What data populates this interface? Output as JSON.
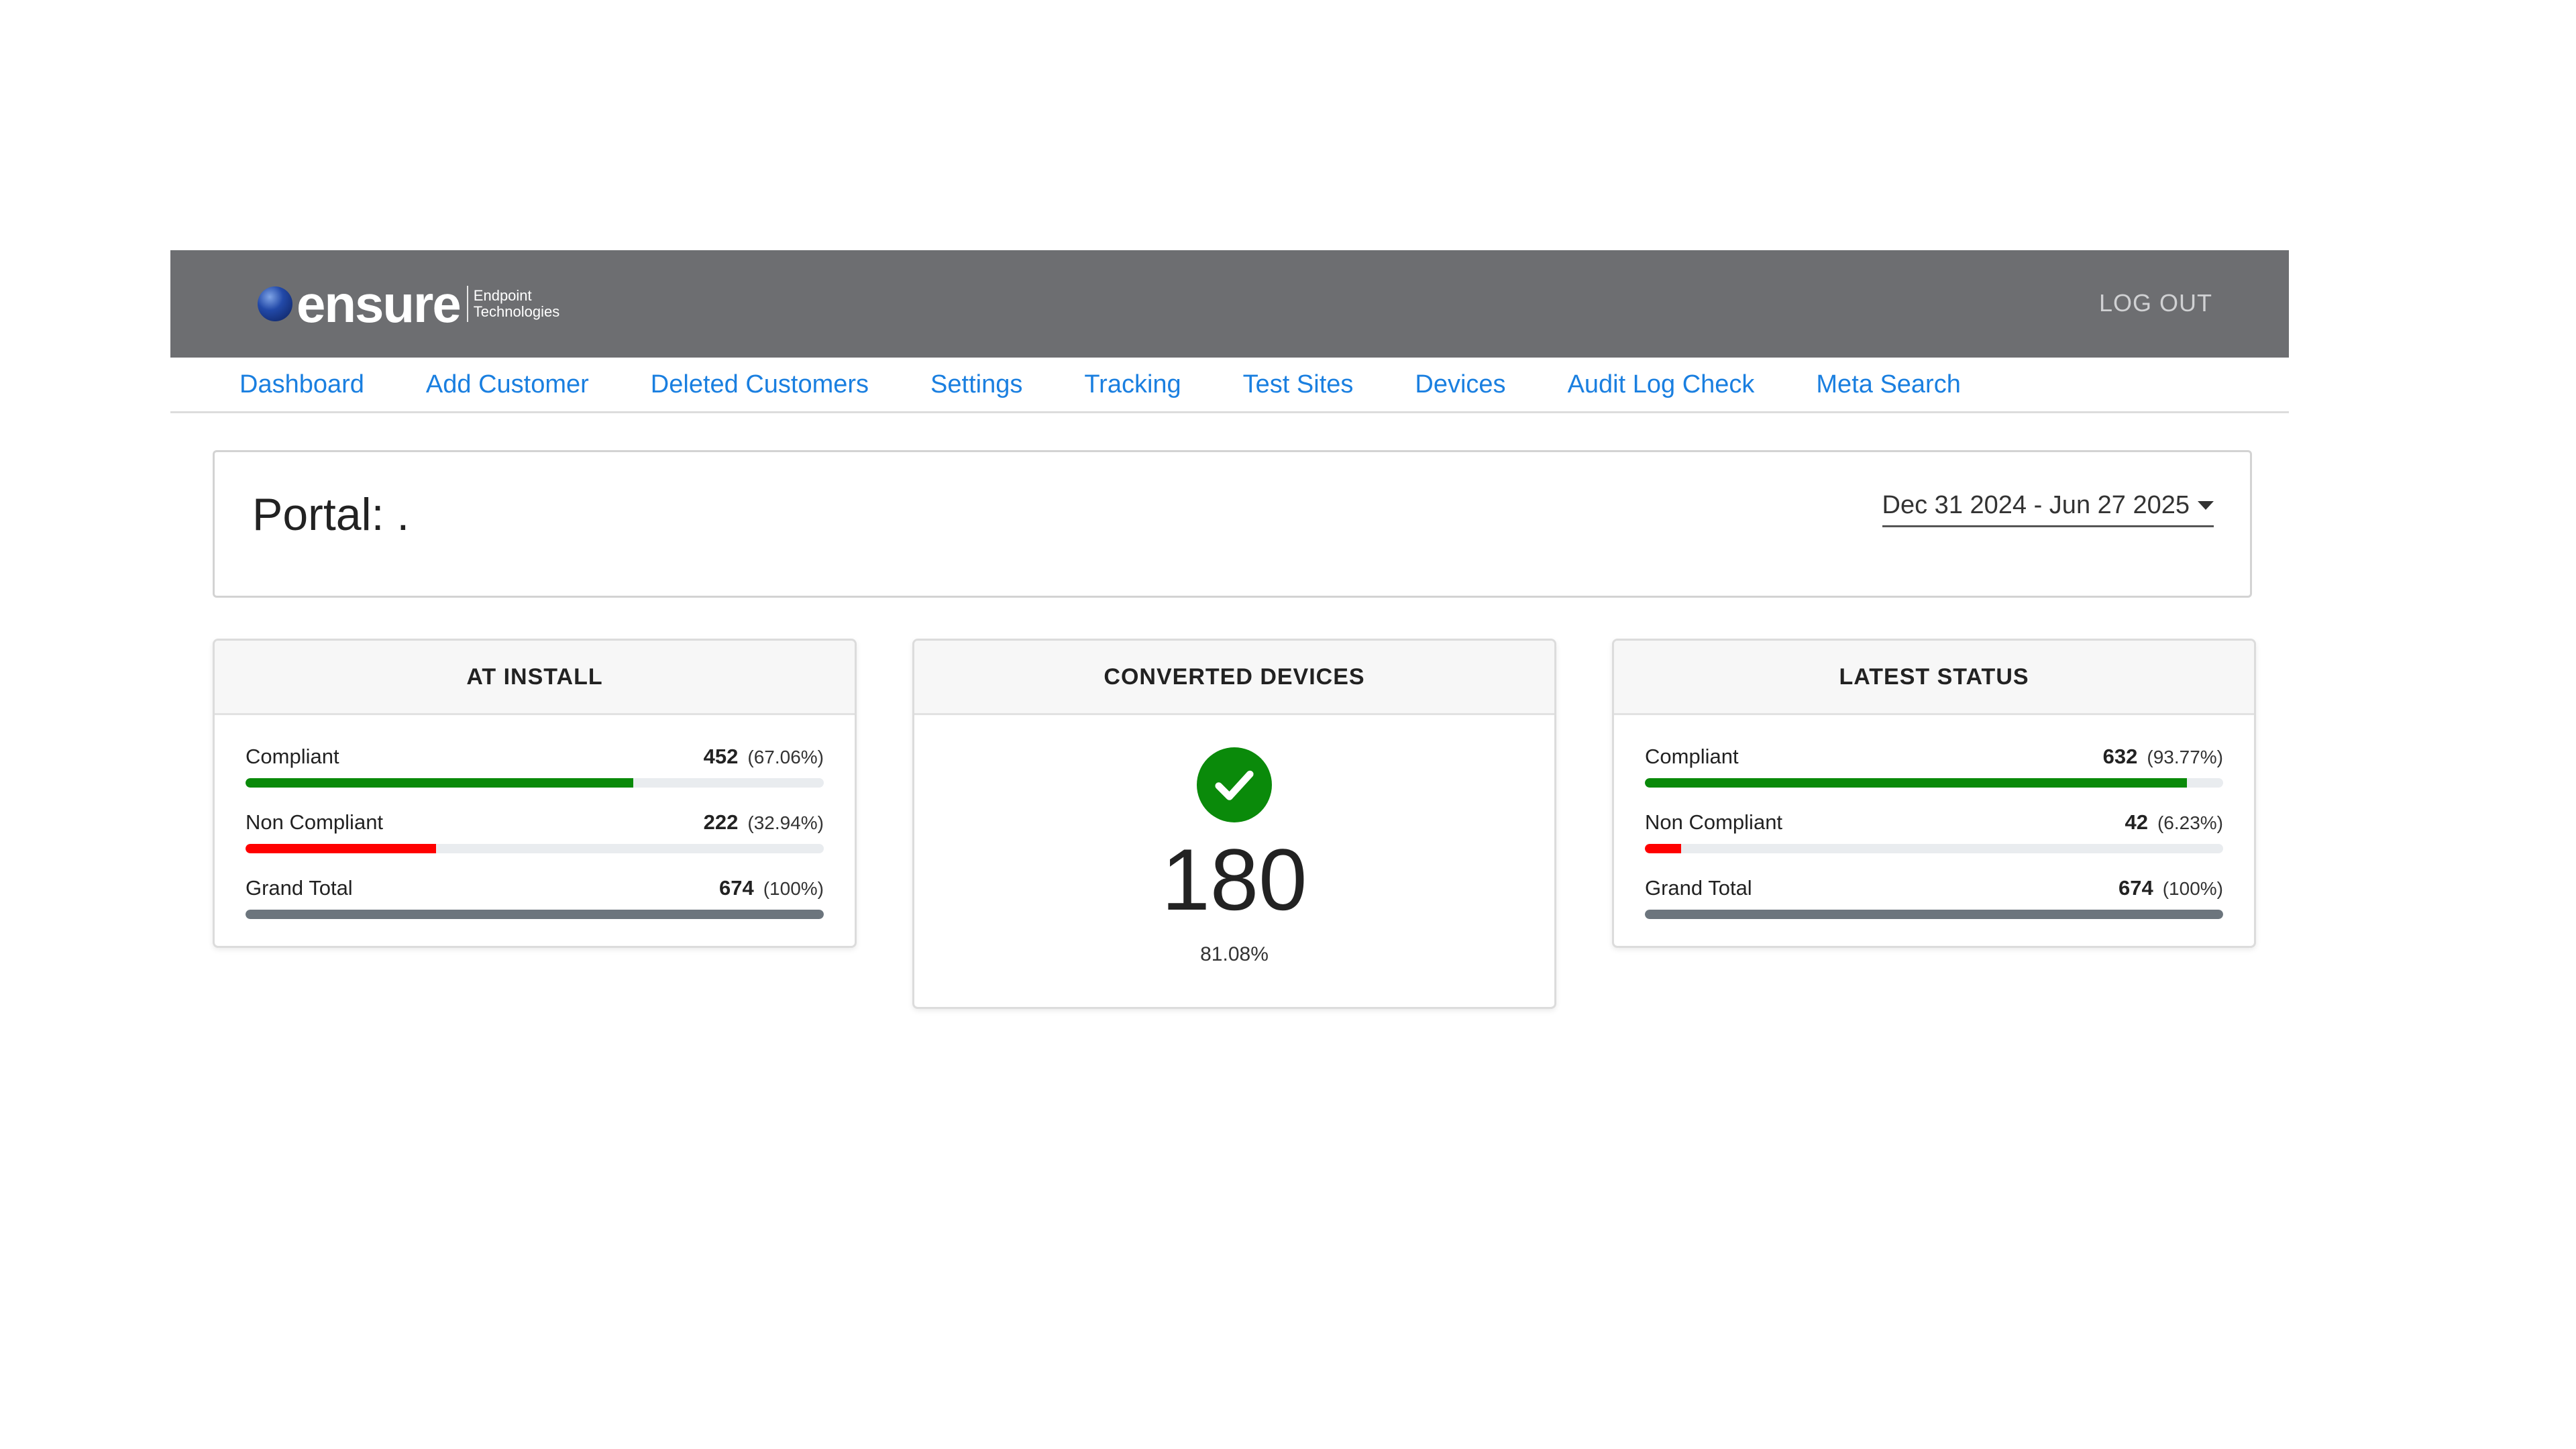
{
  "brand": {
    "name": "ensure",
    "subtitle_line1": "Endpoint",
    "subtitle_line2": "Technologies"
  },
  "header": {
    "logout_label": "LOG OUT"
  },
  "nav": {
    "items": [
      {
        "label": "Dashboard"
      },
      {
        "label": "Add Customer"
      },
      {
        "label": "Deleted Customers"
      },
      {
        "label": "Settings"
      },
      {
        "label": "Tracking"
      },
      {
        "label": "Test Sites"
      },
      {
        "label": "Devices"
      },
      {
        "label": "Audit Log Check"
      },
      {
        "label": "Meta Search"
      }
    ]
  },
  "portal": {
    "title": "Portal: .",
    "date_range": "Dec 31 2024 - Jun 27 2025"
  },
  "cards": {
    "at_install": {
      "title": "AT INSTALL",
      "rows": [
        {
          "label": "Compliant",
          "count": "452",
          "percent": "(67.06%)",
          "fraction": 0.6706,
          "color": "#0a8a0a"
        },
        {
          "label": "Non Compliant",
          "count": "222",
          "percent": "(32.94%)",
          "fraction": 0.3294,
          "color": "#ff0000"
        },
        {
          "label": "Grand Total",
          "count": "674",
          "percent": "(100%)",
          "fraction": 1.0,
          "color": "#6c757d"
        }
      ]
    },
    "converted": {
      "title": "CONVERTED DEVICES",
      "icon": "check-circle-icon",
      "value": "180",
      "percent": "81.08%",
      "icon_color": "#0a8a0a"
    },
    "latest_status": {
      "title": "LATEST STATUS",
      "rows": [
        {
          "label": "Compliant",
          "count": "632",
          "percent": "(93.77%)",
          "fraction": 0.9377,
          "color": "#0a8a0a"
        },
        {
          "label": "Non Compliant",
          "count": "42",
          "percent": "(6.23%)",
          "fraction": 0.0623,
          "color": "#ff0000"
        },
        {
          "label": "Grand Total",
          "count": "674",
          "percent": "(100%)",
          "fraction": 1.0,
          "color": "#6c757d"
        }
      ]
    }
  }
}
